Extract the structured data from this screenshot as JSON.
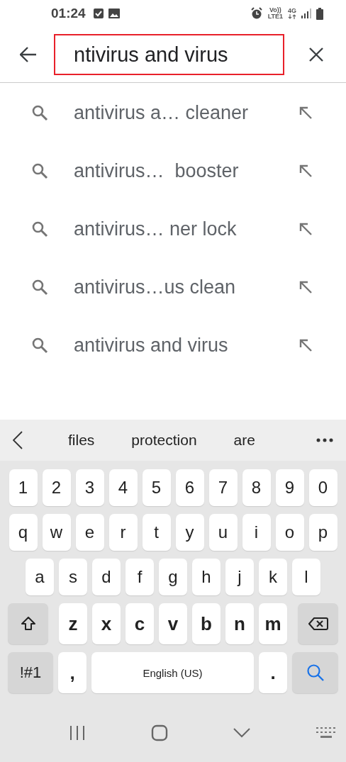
{
  "status_bar": {
    "time": "01:24",
    "volte": "Vo))",
    "lte": "LTE1",
    "network": "4G"
  },
  "search": {
    "value": "ntivirus and virus",
    "highlighted": true
  },
  "suggestions": [
    "antivirus a… cleaner",
    "antivirus…  booster",
    "antivirus… ner lock",
    "antivirus…us clean",
    "antivirus and virus"
  ],
  "keyboard": {
    "word_suggestions": [
      "files",
      "protection",
      "are"
    ],
    "key_rows": [
      {
        "keys": [
          {
            "kind": "char",
            "label": "1"
          },
          {
            "kind": "char",
            "label": "2"
          },
          {
            "kind": "char",
            "label": "3"
          },
          {
            "kind": "char",
            "label": "4"
          },
          {
            "kind": "char",
            "label": "5"
          },
          {
            "kind": "char",
            "label": "6"
          },
          {
            "kind": "char",
            "label": "7"
          },
          {
            "kind": "char",
            "label": "8"
          },
          {
            "kind": "char",
            "label": "9"
          },
          {
            "kind": "char",
            "label": "0"
          }
        ]
      },
      {
        "keys": [
          {
            "kind": "char",
            "label": "q"
          },
          {
            "kind": "char",
            "label": "w"
          },
          {
            "kind": "char",
            "label": "e"
          },
          {
            "kind": "char",
            "label": "r"
          },
          {
            "kind": "char",
            "label": "t"
          },
          {
            "kind": "char",
            "label": "y"
          },
          {
            "kind": "char",
            "label": "u"
          },
          {
            "kind": "char",
            "label": "i"
          },
          {
            "kind": "char",
            "label": "o"
          },
          {
            "kind": "char",
            "label": "p"
          }
        ]
      },
      {
        "keys": [
          {
            "kind": "char",
            "label": "a"
          },
          {
            "kind": "char",
            "label": "s"
          },
          {
            "kind": "char",
            "label": "d"
          },
          {
            "kind": "char",
            "label": "f"
          },
          {
            "kind": "char",
            "label": "g"
          },
          {
            "kind": "char",
            "label": "h"
          },
          {
            "kind": "char",
            "label": "j"
          },
          {
            "kind": "char",
            "label": "k"
          },
          {
            "kind": "char",
            "label": "l"
          }
        ]
      },
      {
        "keys": [
          {
            "kind": "shift"
          },
          {
            "kind": "char",
            "label": "z"
          },
          {
            "kind": "char",
            "label": "x"
          },
          {
            "kind": "char",
            "label": "c"
          },
          {
            "kind": "char",
            "label": "v"
          },
          {
            "kind": "char",
            "label": "b"
          },
          {
            "kind": "char",
            "label": "n"
          },
          {
            "kind": "char",
            "label": "m"
          },
          {
            "kind": "backspace"
          }
        ]
      },
      {
        "keys": [
          {
            "kind": "symbols",
            "label": "!#1"
          },
          {
            "kind": "char",
            "label": ","
          },
          {
            "kind": "space",
            "label": "English (US)"
          },
          {
            "kind": "char",
            "label": "."
          },
          {
            "kind": "search"
          }
        ]
      }
    ]
  }
}
